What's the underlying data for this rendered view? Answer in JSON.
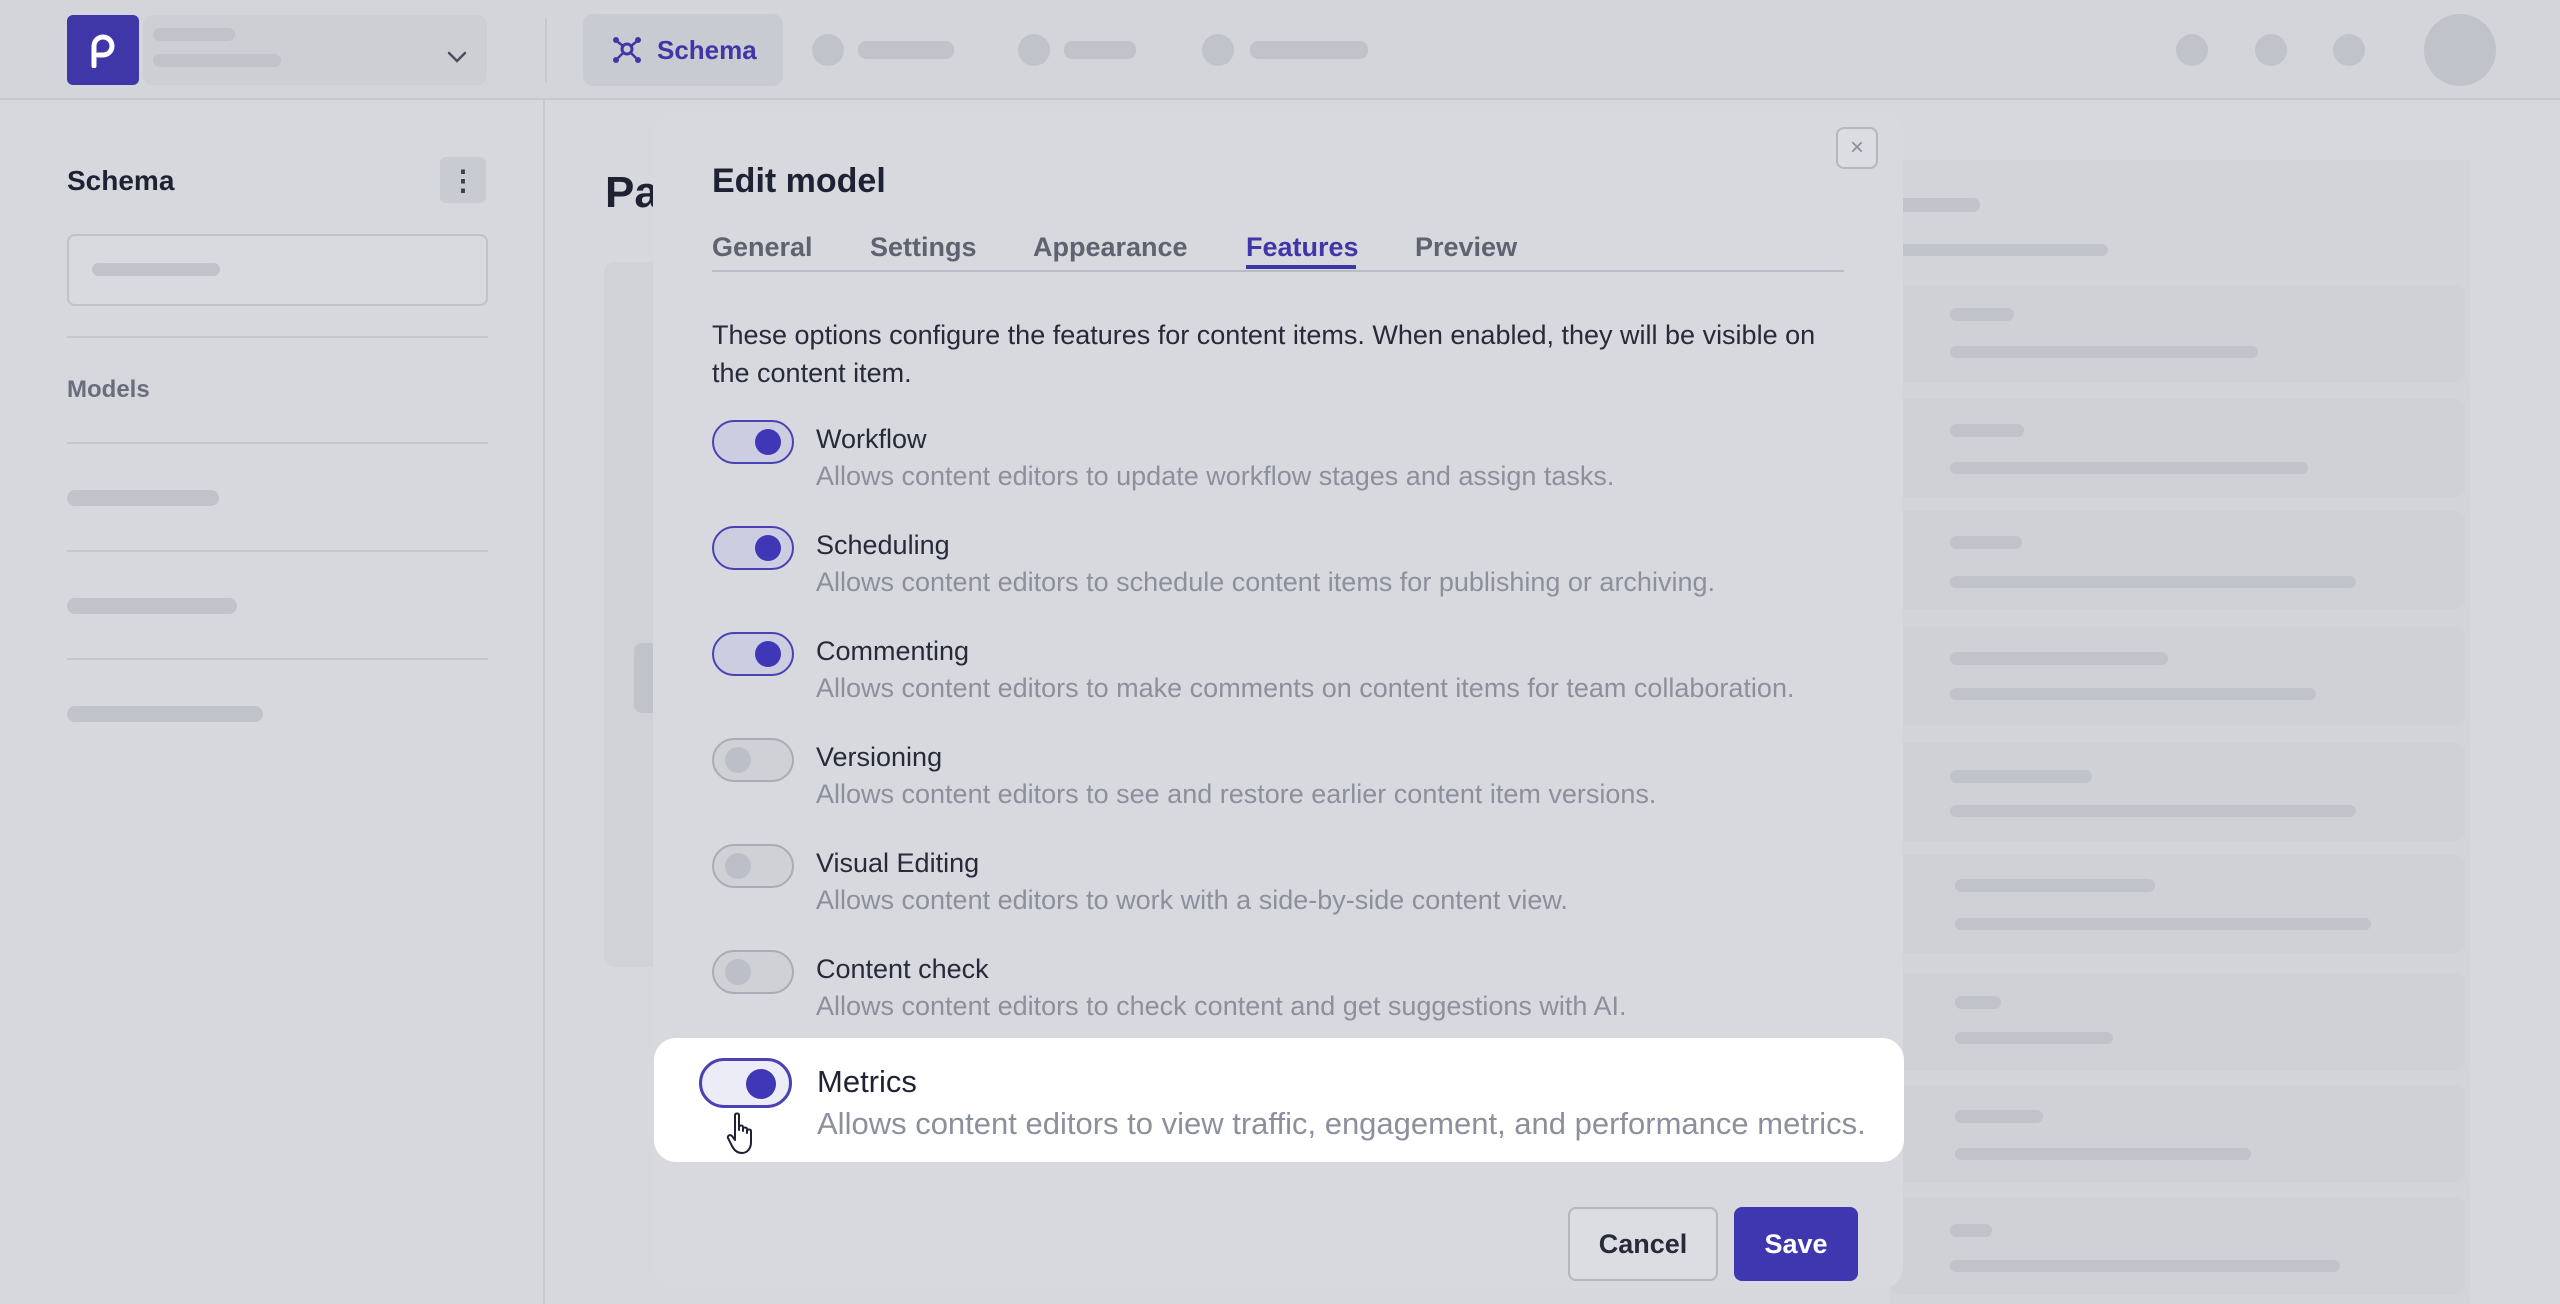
{
  "topbar": {
    "nav_schema_label": "Schema"
  },
  "sidebar": {
    "title": "Schema",
    "section_label": "Models"
  },
  "main": {
    "title_fragment": "Pa"
  },
  "modal": {
    "title": "Edit model",
    "close_icon": "close-icon",
    "tabs": [
      {
        "label": "General",
        "active": false
      },
      {
        "label": "Settings",
        "active": false
      },
      {
        "label": "Appearance",
        "active": false
      },
      {
        "label": "Features",
        "active": true
      },
      {
        "label": "Preview",
        "active": false
      }
    ],
    "intro": "These options configure the features for content items. When enabled, they will be visible on the content item.",
    "features": [
      {
        "name": "Workflow",
        "description": "Allows content editors to update workflow stages and assign tasks.",
        "enabled": true
      },
      {
        "name": "Scheduling",
        "description": "Allows content editors to schedule content items for publishing or archiving.",
        "enabled": true
      },
      {
        "name": "Commenting",
        "description": "Allows content editors to make comments on content items for team collaboration.",
        "enabled": true
      },
      {
        "name": "Versioning",
        "description": "Allows content editors to see and restore earlier content item versions.",
        "enabled": false
      },
      {
        "name": "Visual Editing",
        "description": "Allows content editors to work with a side-by-side content view.",
        "enabled": false
      },
      {
        "name": "Content check",
        "description": "Allows content editors to check content and get suggestions with AI.",
        "enabled": false
      },
      {
        "name": "Metrics",
        "description": "Allows content editors to view traffic, engagement, and performance metrics.",
        "enabled": true
      }
    ],
    "cancel_label": "Cancel",
    "save_label": "Save"
  },
  "colors": {
    "accent": "#3f37a8",
    "highlight_bg": "#ffffff",
    "overlay_bg": "#d6d8dd"
  }
}
